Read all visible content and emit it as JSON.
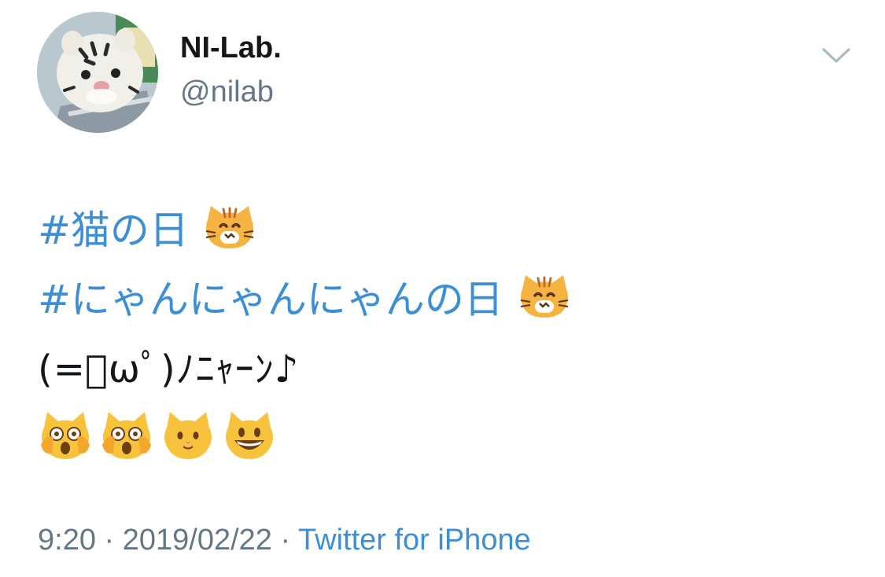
{
  "user": {
    "display_name": "NI-Lab.",
    "handle": "@nilab"
  },
  "tweet": {
    "hashtag1": "#猫の日",
    "hashtag2": "#にゃんにゃんにゃんの日",
    "kaomoji": "(=ﾟωﾟ)ﾉﾆｬｰﾝ♪",
    "emoji_icons": [
      "weary-cat-icon",
      "weary-cat-icon",
      "cat-face-icon",
      "grinning-cat-icon"
    ]
  },
  "meta": {
    "time": "9:20",
    "sep1": " · ",
    "date": "2019/02/22",
    "sep2": " · ",
    "source": "Twitter for iPhone"
  },
  "colors": {
    "link": "#3c8fd6",
    "secondary": "#657786",
    "primary": "#14171a"
  }
}
